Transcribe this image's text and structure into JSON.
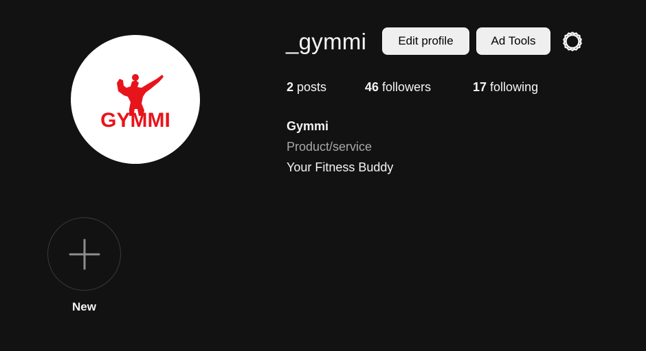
{
  "profile": {
    "username": "_gymmi",
    "logo_text": "GYMMI",
    "stats": {
      "posts_count": "2",
      "posts_label": "posts",
      "followers_count": "46",
      "followers_label": "followers",
      "following_count": "17",
      "following_label": "following"
    },
    "bio": {
      "name": "Gymmi",
      "category": "Product/service",
      "text": "Your Fitness Buddy"
    }
  },
  "actions": {
    "edit_profile_label": "Edit profile",
    "ad_tools_label": "Ad Tools"
  },
  "highlights": {
    "new_label": "New"
  },
  "colors": {
    "background": "#121212",
    "button_bg": "#efefef",
    "brand_red": "#e8141b",
    "muted_text": "#a8a8a8"
  },
  "icons": {
    "settings": "gear-icon",
    "new_highlight": "plus-icon"
  }
}
